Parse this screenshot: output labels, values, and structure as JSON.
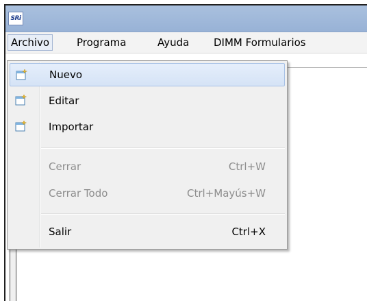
{
  "window": {
    "app_icon_text": "SRi"
  },
  "menubar": {
    "items": [
      {
        "label": "Archivo"
      },
      {
        "label": "Programa"
      },
      {
        "label": "Ayuda"
      },
      {
        "label": "DIMM Formularios"
      }
    ]
  },
  "dropdown": {
    "items": [
      {
        "label": "Nuevo",
        "icon": "new-document-icon",
        "state": "highlighted"
      },
      {
        "label": "Editar",
        "icon": "new-document-icon"
      },
      {
        "label": "Importar",
        "icon": "new-document-icon"
      },
      {
        "label": "Cerrar",
        "shortcut": "Ctrl+W",
        "state": "disabled"
      },
      {
        "label": "Cerrar Todo",
        "shortcut": "Ctrl+Mayús+W",
        "state": "disabled"
      },
      {
        "label": "Salir",
        "shortcut": "Ctrl+X"
      }
    ]
  }
}
